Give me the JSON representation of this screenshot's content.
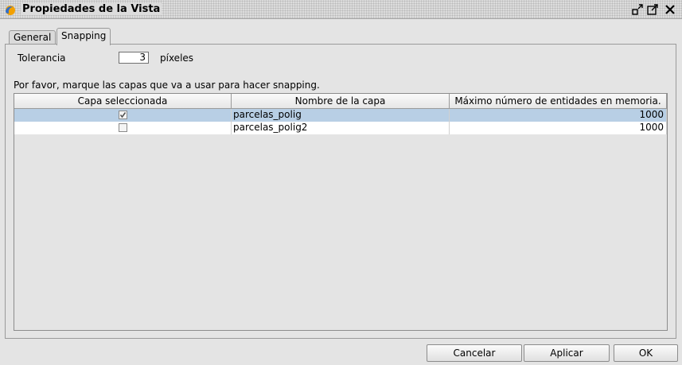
{
  "window": {
    "title": "Propiedades de la Vista",
    "icons": {
      "app": "gvsig-sun-icon",
      "restore": "restore-icon",
      "maximize": "maximize-icon",
      "close": "close-icon"
    }
  },
  "tabs": [
    {
      "label": "General",
      "active": false
    },
    {
      "label": "Snapping",
      "active": true
    }
  ],
  "tolerance": {
    "label": "Tolerancia",
    "value": "3",
    "unit": "píxeles"
  },
  "instruction": "Por favor, marque las capas que va a usar para hacer snapping.",
  "table": {
    "columns": [
      "Capa seleccionada",
      "Nombre de la capa",
      "Máximo número de entidades en memoria."
    ],
    "rows": [
      {
        "selected": true,
        "name": "parcelas_polig",
        "max": "1000",
        "highlighted": true
      },
      {
        "selected": false,
        "name": "parcelas_polig2",
        "max": "1000",
        "highlighted": false
      }
    ]
  },
  "buttons": {
    "cancel": "Cancelar",
    "apply": "Aplicar",
    "ok": "OK"
  },
  "colors": {
    "selection": "#b8cfe5",
    "background": "#e4e4e4",
    "icon_sun": "#f2a000",
    "icon_blue": "#2f6fd0"
  }
}
